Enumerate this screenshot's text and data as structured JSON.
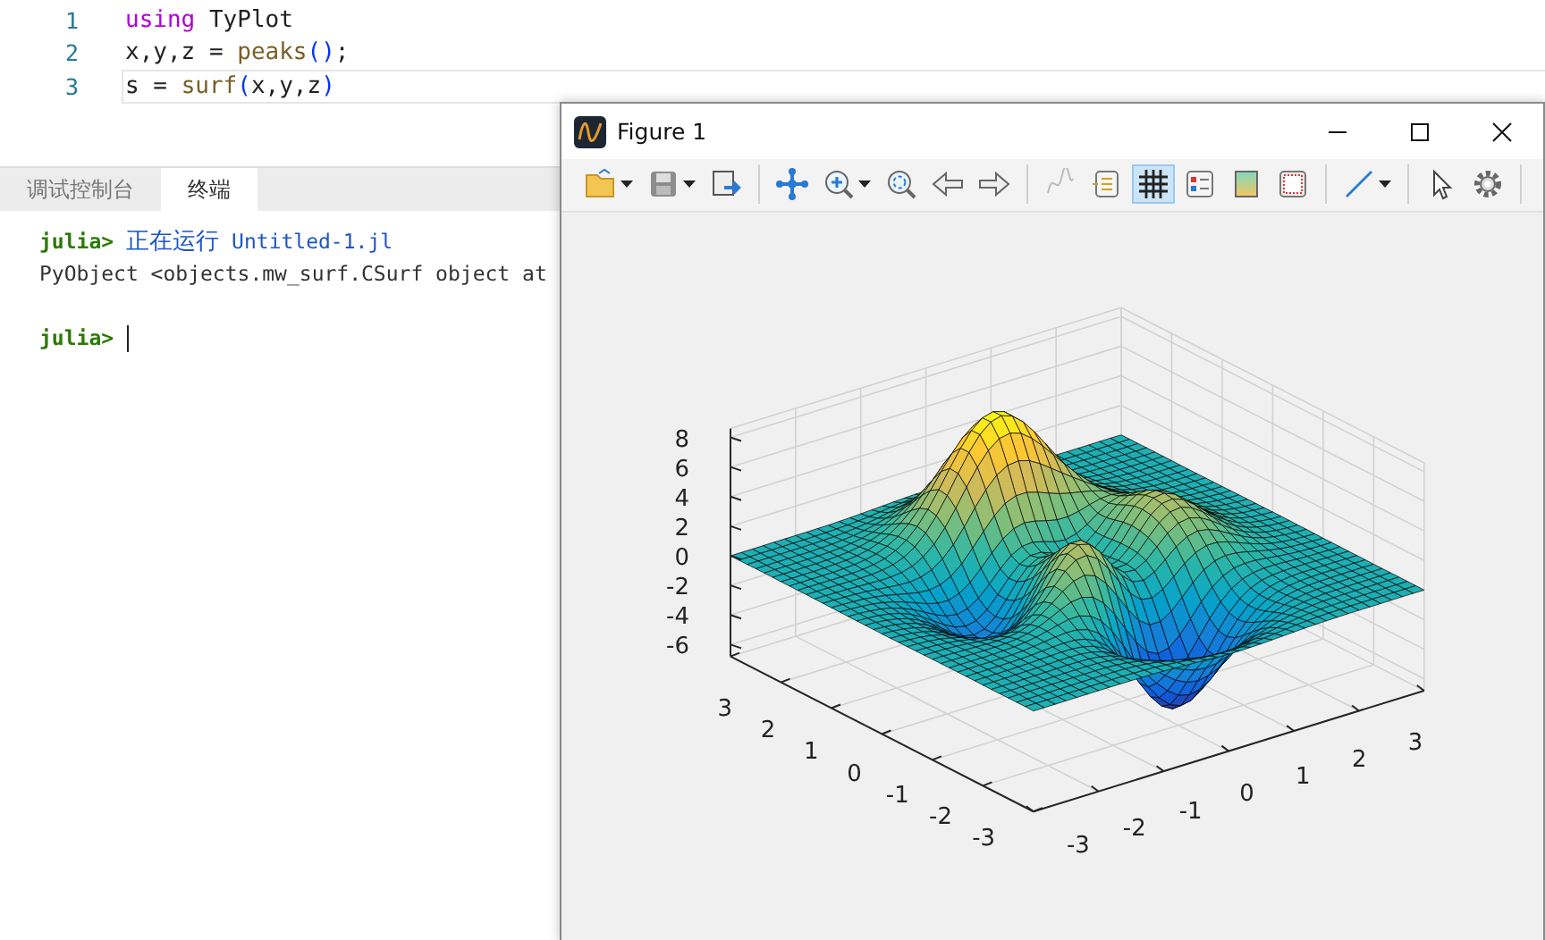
{
  "editor": {
    "lines": [
      {
        "number": "1",
        "current": false,
        "tokens": [
          {
            "text": "using",
            "kind": "keyword"
          },
          {
            "text": " TyPlot",
            "kind": "plain"
          }
        ]
      },
      {
        "number": "2",
        "current": false,
        "tokens": [
          {
            "text": "x,y,z = ",
            "kind": "plain"
          },
          {
            "text": "peaks",
            "kind": "function"
          },
          {
            "text": "()",
            "kind": "bracket"
          },
          {
            "text": ";",
            "kind": "plain"
          }
        ]
      },
      {
        "number": "3",
        "current": true,
        "tokens": [
          {
            "text": "s = ",
            "kind": "plain"
          },
          {
            "text": "surf",
            "kind": "function"
          },
          {
            "text": "(",
            "kind": "bracket"
          },
          {
            "text": "x,y,z",
            "kind": "plain"
          },
          {
            "text": ")",
            "kind": "bracket"
          }
        ]
      }
    ]
  },
  "panel": {
    "tabs": [
      {
        "label": "调试控制台",
        "selected": false
      },
      {
        "label": "终端",
        "selected": true
      }
    ],
    "terminal": [
      {
        "kind": "prompt",
        "prompt": "julia>",
        "message": "正在运行",
        "file": "Untitled-1.jl",
        "cursor": false
      },
      {
        "kind": "output",
        "text": "PyObject <objects.mw_surf.CSurf object at"
      },
      {
        "kind": "blank"
      },
      {
        "kind": "prompt",
        "prompt": "julia>",
        "cursor": true
      }
    ]
  },
  "figure": {
    "title": "Figure 1",
    "toolbar": [
      {
        "kind": "open",
        "dropdown": true,
        "selected": false,
        "disabled": false
      },
      {
        "kind": "save",
        "dropdown": true,
        "selected": false,
        "disabled": false
      },
      {
        "kind": "export",
        "dropdown": false,
        "selected": false,
        "disabled": false
      },
      {
        "kind": "separator"
      },
      {
        "kind": "pan",
        "dropdown": false,
        "selected": false,
        "disabled": false
      },
      {
        "kind": "zoom",
        "dropdown": true,
        "selected": false,
        "disabled": false
      },
      {
        "kind": "fit",
        "dropdown": false,
        "selected": false,
        "disabled": false
      },
      {
        "kind": "back",
        "dropdown": false,
        "selected": false,
        "disabled": false
      },
      {
        "kind": "forward",
        "dropdown": false,
        "selected": false,
        "disabled": false
      },
      {
        "kind": "separator"
      },
      {
        "kind": "datatip",
        "dropdown": false,
        "selected": false,
        "disabled": true
      },
      {
        "kind": "legend",
        "dropdown": false,
        "selected": false,
        "disabled": false
      },
      {
        "kind": "grid",
        "dropdown": false,
        "selected": true,
        "disabled": false
      },
      {
        "kind": "panel",
        "dropdown": false,
        "selected": false,
        "disabled": false
      },
      {
        "kind": "colorbar",
        "dropdown": false,
        "selected": false,
        "disabled": false
      },
      {
        "kind": "box",
        "dropdown": false,
        "selected": false,
        "disabled": false
      },
      {
        "kind": "separator"
      },
      {
        "kind": "line",
        "dropdown": true,
        "selected": false,
        "disabled": false
      },
      {
        "kind": "separator"
      },
      {
        "kind": "select",
        "dropdown": false,
        "selected": false,
        "disabled": false
      },
      {
        "kind": "settings",
        "dropdown": false,
        "selected": false,
        "disabled": false
      },
      {
        "kind": "separator"
      }
    ],
    "plot": {
      "z_ticks": [
        "8",
        "6",
        "4",
        "2",
        "0",
        "-2",
        "-4",
        "-6"
      ],
      "y_ticks": [
        "3",
        "2",
        "1",
        "0",
        "-1",
        "-2",
        "-3"
      ],
      "x_ticks": [
        "-3",
        "-2",
        "-1",
        "0",
        "1",
        "2",
        "3"
      ]
    }
  }
}
